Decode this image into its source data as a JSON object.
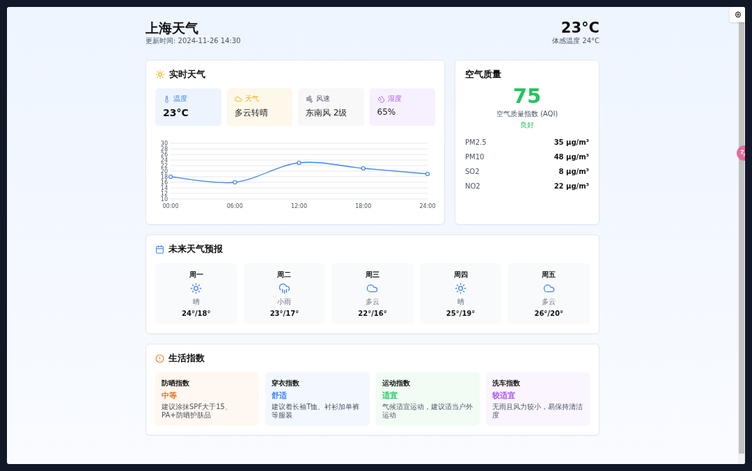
{
  "header": {
    "city": "上海天气",
    "updated": "更新时间: 2024-11-26 14:30",
    "temperature": "23°C",
    "feels_like": "体感温度 24°C"
  },
  "current": {
    "title": "实时天气",
    "stats": [
      {
        "kind": "temperature",
        "label": "温度",
        "value": "23°C"
      },
      {
        "kind": "weather",
        "label": "天气",
        "value": "多云转晴"
      },
      {
        "kind": "wind",
        "label": "风速",
        "value": "东南风 2级"
      },
      {
        "kind": "humidity",
        "label": "湿度",
        "value": "65%"
      }
    ],
    "chart_data": {
      "type": "line",
      "categories": [
        "00:00",
        "06:00",
        "12:00",
        "18:00",
        "24:00"
      ],
      "series": [
        {
          "color": "#3b82f6",
          "marker": "circle",
          "values": [
            18,
            16,
            23,
            21,
            19
          ]
        }
      ],
      "grid": true,
      "ylim": [
        10,
        30
      ],
      "yticks": [
        10,
        12,
        14,
        16,
        18,
        20,
        22,
        24,
        26,
        28,
        30
      ]
    }
  },
  "air_quality": {
    "title": "空气质量",
    "aqi": "75",
    "aqi_label": "空气质量指数 (AQI)",
    "status": "良好",
    "pollutants": [
      {
        "name": "PM2.5",
        "value": "35 μg/m³"
      },
      {
        "name": "PM10",
        "value": "48 μg/m³"
      },
      {
        "name": "SO2",
        "value": "8 μg/m³"
      },
      {
        "name": "NO2",
        "value": "22 μg/m³"
      }
    ]
  },
  "forecast": {
    "title": "未来天气预报",
    "days": [
      {
        "day": "周一",
        "kind": "sunny",
        "condition": "晴",
        "temps": "24°/18°"
      },
      {
        "day": "周二",
        "kind": "rain",
        "condition": "小雨",
        "temps": "23°/17°"
      },
      {
        "day": "周三",
        "kind": "cloudy",
        "condition": "多云",
        "temps": "22°/16°"
      },
      {
        "day": "周四",
        "kind": "sunny",
        "condition": "晴",
        "temps": "25°/19°"
      },
      {
        "day": "周五",
        "kind": "cloudy",
        "condition": "多云",
        "temps": "26°/20°"
      }
    ]
  },
  "life": {
    "title": "生活指数",
    "items": [
      {
        "name": "防晒指数",
        "level_text": "中等",
        "advice": "建议涂抹SPF大于15、PA+防晒护肤品",
        "color": "#f97316"
      },
      {
        "name": "穿衣指数",
        "level_text": "舒适",
        "advice": "建议着长袖T恤、衬衫加单裤等服装",
        "color": "#3b82f6"
      },
      {
        "name": "运动指数",
        "level_text": "适宜",
        "advice": "气候适宜运动，建议适当户外运动",
        "color": "#22c55e"
      },
      {
        "name": "洗车指数",
        "level_text": "较适宜",
        "advice": "无雨且风力较小，易保持清洁度",
        "color": "#a855f7"
      }
    ]
  }
}
